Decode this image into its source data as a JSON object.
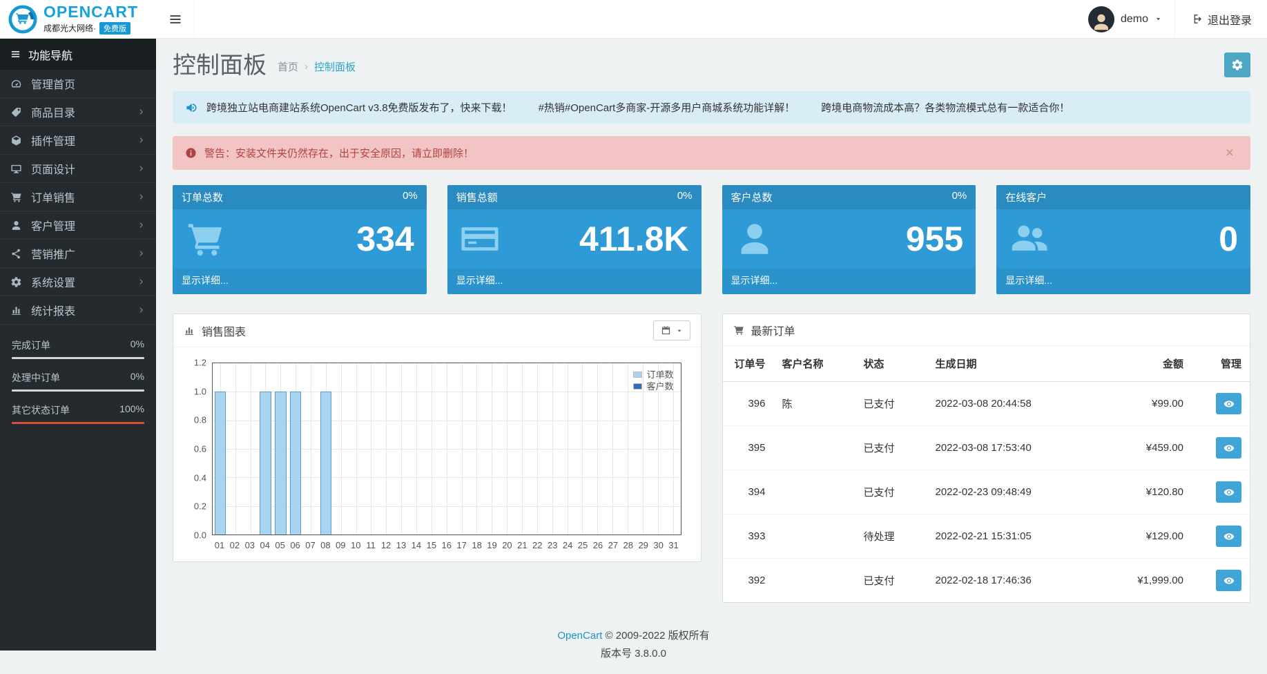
{
  "header": {
    "logo_title": "OPENCART",
    "logo_subtitle": "成都光大网络·",
    "logo_badge": "免费版",
    "user_name": "demo",
    "logout_label": "退出登录"
  },
  "sidebar": {
    "nav_header": "功能导航",
    "items": [
      {
        "name": "dashboard",
        "label": "管理首页",
        "icon": "dashboard-icon",
        "has_submenu": false
      },
      {
        "name": "catalog",
        "label": "商品目录",
        "icon": "tag-icon",
        "has_submenu": true
      },
      {
        "name": "extensions",
        "label": "插件管理",
        "icon": "puzzle-icon",
        "has_submenu": true
      },
      {
        "name": "design",
        "label": "页面设计",
        "icon": "monitor-icon",
        "has_submenu": true
      },
      {
        "name": "sales",
        "label": "订单销售",
        "icon": "cart-icon",
        "has_submenu": true
      },
      {
        "name": "customers",
        "label": "客户管理",
        "icon": "user-icon",
        "has_submenu": true
      },
      {
        "name": "marketing",
        "label": "营销推广",
        "icon": "share-icon",
        "has_submenu": true
      },
      {
        "name": "system",
        "label": "系统设置",
        "icon": "gear-icon",
        "has_submenu": true
      },
      {
        "name": "reports",
        "label": "统计报表",
        "icon": "bar-chart-icon",
        "has_submenu": true
      }
    ],
    "order_stats": [
      {
        "label": "完成订单",
        "value": "0%",
        "color": "#00a65a"
      },
      {
        "label": "处理中订单",
        "value": "0%",
        "color": "#f39c12"
      },
      {
        "label": "其它状态订单",
        "value": "100%",
        "color": "#dd4b39"
      }
    ]
  },
  "page": {
    "title": "控制面板",
    "breadcrumb": {
      "home": "首页",
      "current": "控制面板"
    },
    "announcement_items": [
      "跨境独立站电商建站系统OpenCart v3.8免费版发布了，快来下载！",
      "#热销#OpenCart多商家-开源多用户商城系统功能详解！",
      "跨境电商物流成本高？各类物流模式总有一款适合你！"
    ],
    "warning": "警告：安装文件夹仍然存在，出于安全原因，请立即删除！",
    "warning_close": "×"
  },
  "tiles": [
    {
      "title": "订单总数",
      "percent": "0%",
      "value": "334",
      "link": "显示详细...",
      "icon": "cart-icon"
    },
    {
      "title": "销售总额",
      "percent": "0%",
      "value": "411.8K",
      "link": "显示详细...",
      "icon": "credit-card-icon"
    },
    {
      "title": "客户总数",
      "percent": "0%",
      "value": "955",
      "link": "显示详细...",
      "icon": "user-icon"
    },
    {
      "title": "在线客户",
      "percent": "",
      "value": "0",
      "link": "显示详细...",
      "icon": "users-icon"
    }
  ],
  "sales_panel": {
    "title": "销售图表"
  },
  "chart_data": {
    "type": "bar",
    "title": "销售图表",
    "categories": [
      "01",
      "02",
      "03",
      "04",
      "05",
      "06",
      "07",
      "08",
      "09",
      "10",
      "11",
      "12",
      "13",
      "14",
      "15",
      "16",
      "17",
      "18",
      "19",
      "20",
      "21",
      "22",
      "23",
      "24",
      "25",
      "26",
      "27",
      "28",
      "29",
      "30",
      "31"
    ],
    "series": [
      {
        "name": "订单数",
        "fill": "#a9d4f0",
        "stroke": "#5c9bd1",
        "values": [
          1,
          0,
          0,
          1,
          1,
          1,
          0,
          1,
          0,
          0,
          0,
          0,
          0,
          0,
          0,
          0,
          0,
          0,
          0,
          0,
          0,
          0,
          0,
          0,
          0,
          0,
          0,
          0,
          0,
          0,
          0
        ]
      },
      {
        "name": "客户数",
        "fill": "#2a6fba",
        "stroke": "#2a6fba",
        "values": [
          0,
          0,
          0,
          0,
          0,
          0,
          0,
          0,
          0,
          0,
          0,
          0,
          0,
          0,
          0,
          0,
          0,
          0,
          0,
          0,
          0,
          0,
          0,
          0,
          0,
          0,
          0,
          0,
          0,
          0,
          0
        ]
      }
    ],
    "xlabel": "",
    "ylabel": "",
    "ylim": [
      0,
      1.2
    ],
    "yticks": [
      0,
      0.2,
      0.4,
      0.6,
      0.8,
      1.0,
      1.2
    ],
    "grid": true,
    "legend_position": "top-right"
  },
  "orders_panel": {
    "title": "最新订单",
    "columns": [
      "订单号",
      "客户名称",
      "状态",
      "生成日期",
      "金额",
      "管理"
    ],
    "rows": [
      {
        "id": "396",
        "customer": "陈",
        "status": "已支付",
        "date": "2022-03-08 20:44:58",
        "total": "¥99.00"
      },
      {
        "id": "395",
        "customer": "",
        "status": "已支付",
        "date": "2022-03-08 17:53:40",
        "total": "¥459.00"
      },
      {
        "id": "394",
        "customer": "",
        "status": "已支付",
        "date": "2022-02-23 09:48:49",
        "total": "¥120.80"
      },
      {
        "id": "393",
        "customer": "",
        "status": "待处理",
        "date": "2022-02-21 15:31:05",
        "total": "¥129.00"
      },
      {
        "id": "392",
        "customer": "",
        "status": "已支付",
        "date": "2022-02-18 17:46:36",
        "total": "¥1,999.00"
      }
    ]
  },
  "footer": {
    "copyright_link": "OpenCart",
    "copyright_text": " © 2009-2022 版权所有",
    "version": "版本号 3.8.0.0"
  }
}
